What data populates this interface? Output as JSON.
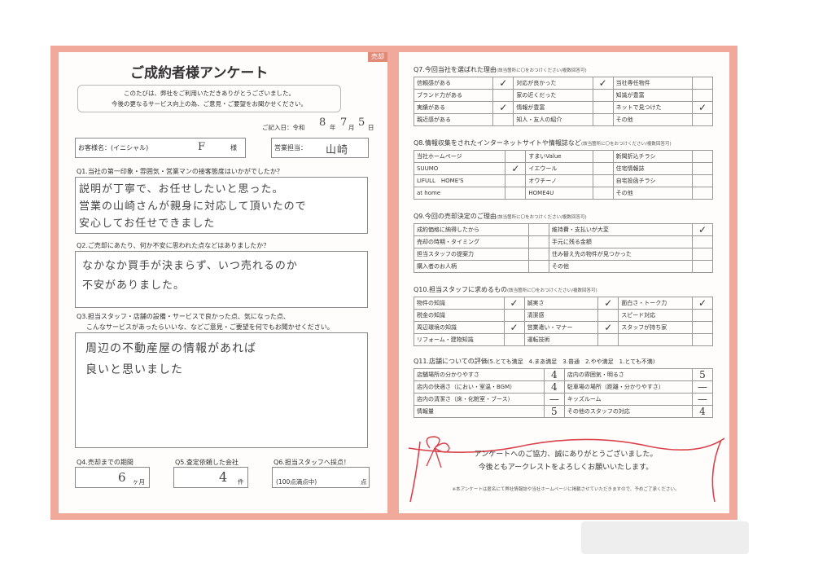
{
  "title": "ご成約者様アンケート",
  "tag": "売却",
  "intro": [
    "このたびは、弊社をご利用いただきありがとうございました。",
    "今後の更なるサービス向上の為、ご意見・ご要望をお聞かせください。"
  ],
  "date": {
    "label": "ご記入日：令和",
    "year": "8",
    "year_unit": "年",
    "month": "7",
    "month_unit": "月",
    "day": "5",
    "day_unit": "日"
  },
  "customer": {
    "label": "お客様名：(イニシャル)",
    "value": "F",
    "suffix": "様"
  },
  "staff": {
    "label": "営業担当：",
    "value": "山崎"
  },
  "q1": {
    "question": "Q1.当社の第一印象・雰囲気・営業マンの接客態度はいかがでしたか？",
    "answer": [
      "説明が丁寧で、お任せしたいと思った。",
      "営業の山崎さんが親身に対応して頂いたので",
      "安心してお任せできました"
    ]
  },
  "q2": {
    "question": "Q2.ご売却にあたり、何か不安に思われた点などはありましたか？",
    "answer": [
      "なかなか買手が決まらず、いつ売れるのか",
      "不安がありました。"
    ]
  },
  "q3": {
    "question": [
      "Q3.担当スタッフ・店舗の設備・サービスで良かった点、気になった点、",
      "こんなサービスがあったらいいな、などご意見・ご要望を何でもお聞かせください。"
    ],
    "answer": [
      "周辺の不動産屋の情報があれば",
      "良いと思いました"
    ]
  },
  "q4": {
    "question": "Q4.売却までの期間",
    "value": "6",
    "unit": "ヶ月"
  },
  "q5": {
    "question": "Q5.査定依頼した会社",
    "value": "4",
    "unit": "件"
  },
  "q6": {
    "question": "Q6.担当スタッフへ採点！",
    "note": "(100点満点中)",
    "unit": "点"
  },
  "q7": {
    "title": "Q7.今回当社を選ばれた理由",
    "note": "(該当箇所に〇をおつけください/複数回答可)",
    "rows": [
      [
        "信頼感がある",
        "✓",
        "対応が良かった",
        "✓",
        "当社専任物件",
        ""
      ],
      [
        "ブランド力がある",
        "",
        "家の近くだった",
        "",
        "知識が豊富",
        ""
      ],
      [
        "実績がある",
        "✓",
        "情報が豊富",
        "",
        "ネットで見つけた",
        "✓"
      ],
      [
        "親近感がある",
        "",
        "知人・友人の紹介",
        "",
        "その他",
        ""
      ]
    ]
  },
  "q8": {
    "title": "Q8.情報収集をされたインターネットサイトや情報誌など",
    "note": "(該当箇所に〇をおつけください/複数回答可)",
    "rows": [
      [
        "当社ホームページ",
        "",
        "すまいValue",
        "",
        "新聞折込チラシ",
        ""
      ],
      [
        "SUUMO",
        "✓",
        "イエウール",
        "",
        "住宅情報誌",
        ""
      ],
      [
        "LIFULL　HOME'S",
        "",
        "オウチーノ",
        "",
        "自宅投函チラシ",
        ""
      ],
      [
        "at home",
        "",
        "HOME4U",
        "",
        "その他",
        ""
      ]
    ]
  },
  "q9": {
    "title": "Q9.今回の売却決定のご理由",
    "note": "(該当箇所に〇をおつけください/複数回答可)",
    "rows": [
      [
        "成約価格に納得したから",
        "",
        "維持費・支払いが大変",
        "✓"
      ],
      [
        "売却の時期・タイミング",
        "",
        "手元に残る金額",
        ""
      ],
      [
        "担当スタッフの提案力",
        "",
        "住み替え先の物件が見つかった",
        ""
      ],
      [
        "購入者のお人柄",
        "",
        "その他",
        ""
      ]
    ]
  },
  "q10": {
    "title": "Q10.担当スタッフに求めるもの",
    "note": "(該当箇所に〇をおつけください/複数回答可)",
    "rows": [
      [
        "物件の知識",
        "✓",
        "誠実さ",
        "✓",
        "面白さ・トーク力",
        "✓"
      ],
      [
        "税金の知識",
        "",
        "清潔感",
        "",
        "スピード対応",
        ""
      ],
      [
        "周辺環境の知識",
        "✓",
        "営業遣い・マナー",
        "✓",
        "スタッフが持ち家",
        ""
      ],
      [
        "リフォーム・建物知識",
        "",
        "運転技術",
        "",
        "",
        ""
      ]
    ]
  },
  "q11": {
    "title": "Q11.店舗についての評価",
    "scale": "(5.とても満足　4.まあ満足　3.普通　2.やや満足　1.とても不満)",
    "rows": [
      [
        "店舗場所の分かりやすさ",
        "4",
        "店内の雰囲気・明るさ",
        "5"
      ],
      [
        "店内の快適さ（におい・室温・BGM）",
        "4",
        "駐車場の場所（距離・分かりやすさ）",
        "—"
      ],
      [
        "店内の清潔さ（床・化粧室・ブース）",
        "—",
        "キッズルーム",
        "—"
      ],
      [
        "情報量",
        "5",
        "その他のスタッフの対応",
        "4"
      ]
    ]
  },
  "thanks": [
    "アンケートへのご協力、誠にありがとうございました。",
    "今後ともアークレストをよろしくお願いいたします。"
  ],
  "footer": "※本アンケートは匿名にて弊社情報誌や当社ホームページに掲載させていただきますので、予めご了承ください。",
  "colors": {
    "frame": "#f0a99a",
    "ribbon": "#d9434e"
  }
}
